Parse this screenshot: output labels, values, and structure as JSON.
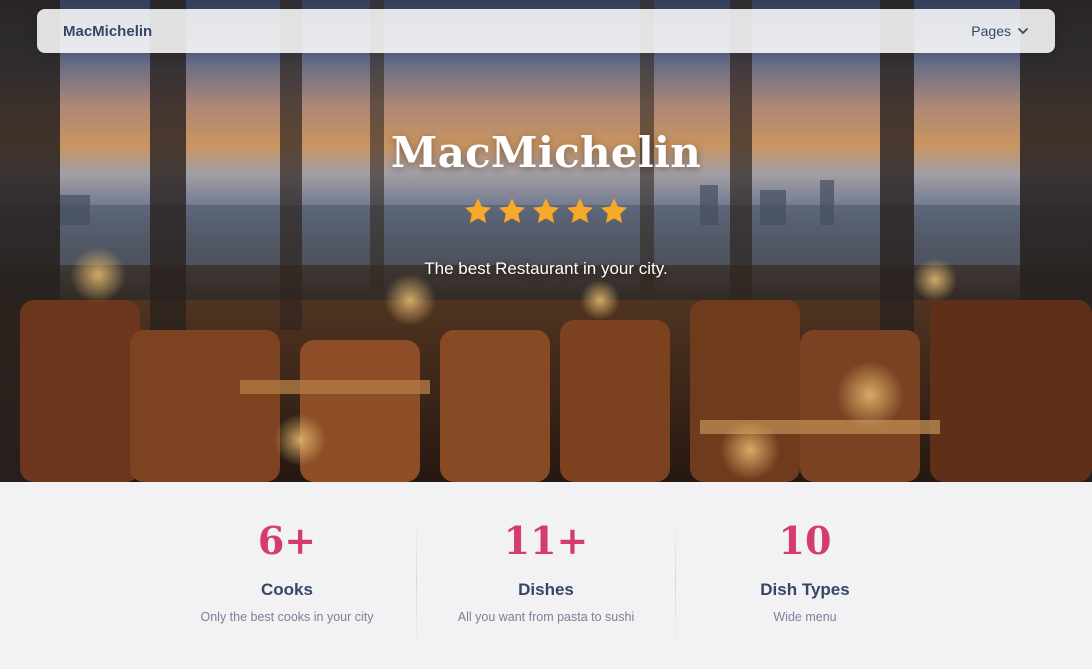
{
  "navbar": {
    "brand": "MacMichelin",
    "pages_label": "Pages",
    "pages_icon": "chevron-down-icon"
  },
  "hero": {
    "title": "MacMichelin",
    "rating": 5,
    "rating_max": 5,
    "star_color": "#f7a928",
    "subtitle": "The best Restaurant in your city."
  },
  "stats": [
    {
      "value": "6+",
      "label": "Cooks",
      "description": "Only the best cooks in your city"
    },
    {
      "value": "11+",
      "label": "Dishes",
      "description": "All you want from pasta to sushi"
    },
    {
      "value": "10",
      "label": "Dish Types",
      "description": "Wide menu"
    }
  ],
  "colors": {
    "accent": "#d63c6b",
    "heading": "#344767",
    "muted": "#7b809a",
    "background": "#f2f2f5"
  }
}
